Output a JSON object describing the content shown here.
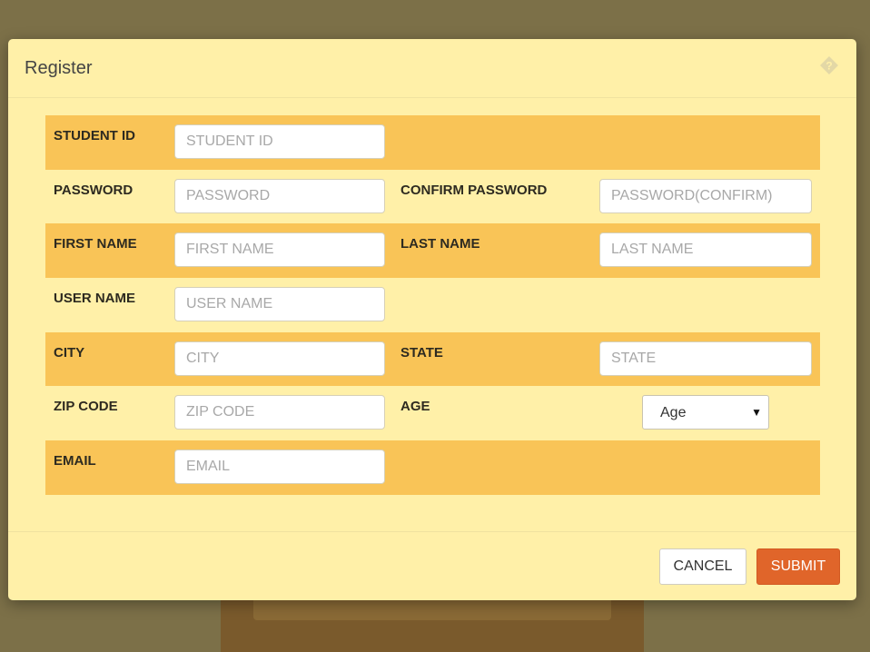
{
  "modal": {
    "title": "Register",
    "help_icon": "question-diamond-icon"
  },
  "form": {
    "student_id": {
      "label": "STUDENT ID",
      "placeholder": "STUDENT ID"
    },
    "password": {
      "label": "PASSWORD",
      "placeholder": "PASSWORD"
    },
    "confirm_password": {
      "label": "CONFIRM PASSWORD",
      "placeholder": "PASSWORD(CONFIRM)"
    },
    "first_name": {
      "label": "FIRST NAME",
      "placeholder": "FIRST NAME"
    },
    "last_name": {
      "label": "LAST NAME",
      "placeholder": "LAST NAME"
    },
    "user_name": {
      "label": "USER NAME",
      "placeholder": "USER NAME"
    },
    "city": {
      "label": "CITY",
      "placeholder": "CITY"
    },
    "state": {
      "label": "STATE",
      "placeholder": "STATE"
    },
    "zip_code": {
      "label": "ZIP CODE",
      "placeholder": "ZIP CODE"
    },
    "age": {
      "label": "AGE",
      "selected": "Age"
    },
    "email": {
      "label": "EMAIL",
      "placeholder": "EMAIL"
    }
  },
  "footer": {
    "cancel_label": "CANCEL",
    "submit_label": "SUBMIT"
  },
  "colors": {
    "modal_bg": "#fff0a8",
    "row_alt": "#f9c457",
    "submit": "#e0652a",
    "overlay": "#7c7048"
  }
}
